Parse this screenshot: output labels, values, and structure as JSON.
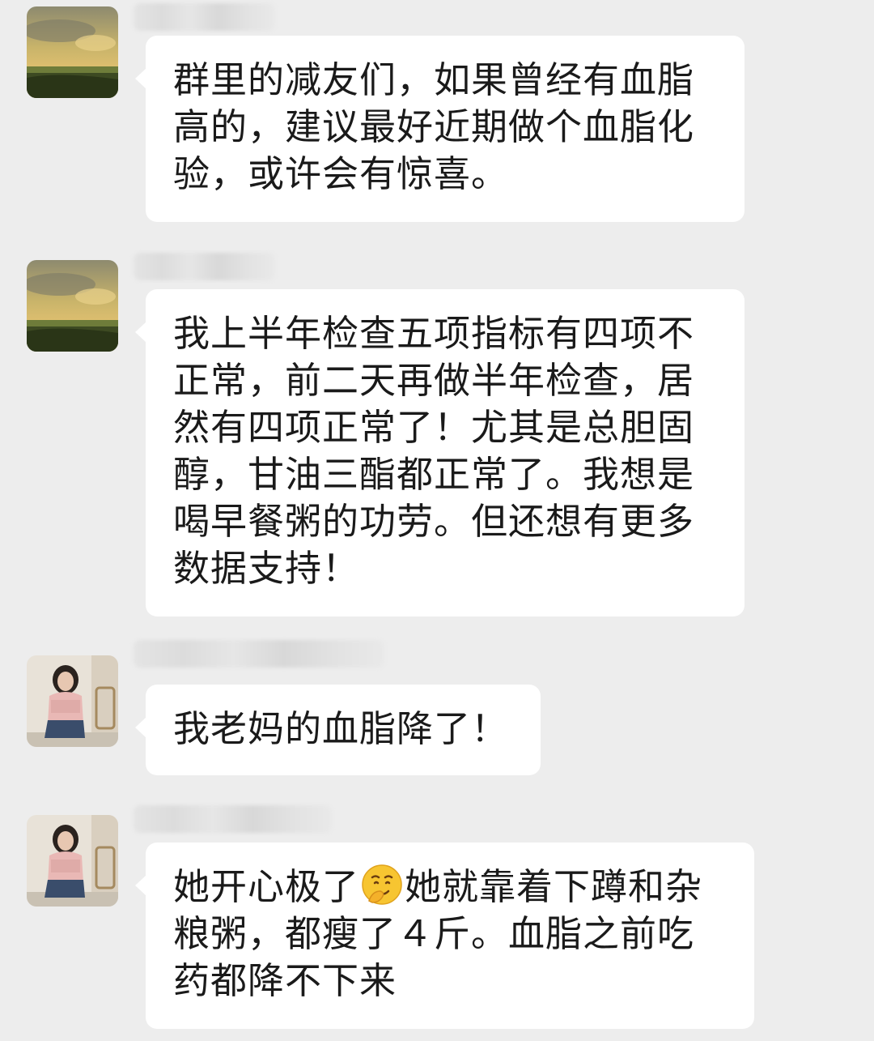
{
  "messages": [
    {
      "avatar": "landscape-avatar",
      "sender_name": "",
      "text": "群里的减友们，如果曾经有血脂\n高的，建议最好近期做个血脂化\n验，或许会有惊喜。"
    },
    {
      "avatar": "landscape-avatar",
      "sender_name": "",
      "text": "我上半年检查五项指标有四项不\n正常，前二天再做半年检查，居\n然有四项正常了！尤其是总胆固\n醇，甘油三酯都正常了。我想是\n喝早餐粥的功劳。但还想有更多\n数据支持！"
    },
    {
      "avatar": "woman-photo-avatar",
      "sender_name": "",
      "text": "我老妈的血脂降了！"
    },
    {
      "avatar": "woman-photo-avatar",
      "sender_name": "",
      "text_before_emoji": "她开心极了",
      "emoji": "smirk-emoji-icon",
      "text_after_emoji": "她就靠着下蹲和杂\n粮粥，都瘦了４斤。血脂之前吃\n药都降不下来"
    }
  ],
  "colors": {
    "background": "#ededed",
    "bubble": "#ffffff",
    "text": "#1a1a1a"
  }
}
